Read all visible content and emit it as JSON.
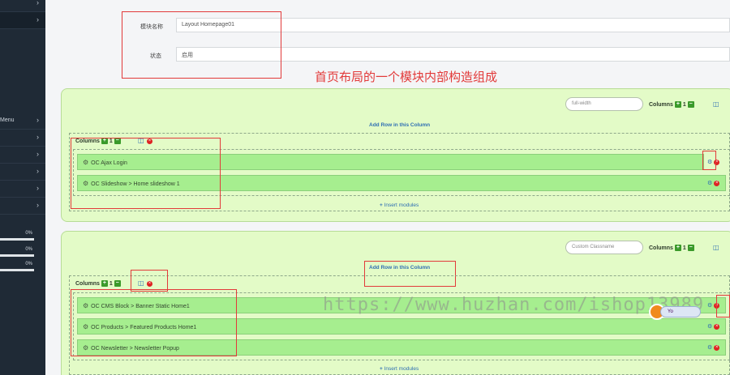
{
  "sidebar": {
    "menu_label": "Menu",
    "progress": [
      {
        "value": "0%"
      },
      {
        "value": "0%"
      },
      {
        "value": "0%"
      }
    ]
  },
  "form": {
    "module_name_label": "模块名称",
    "module_name_value": "Layout Homepage01",
    "status_label": "状态",
    "status_value": "启用"
  },
  "caption": "首页布局的一个模块内部构造组成",
  "panel1": {
    "class_input": "full-width",
    "columns_label": "Columns",
    "columns_count": "1",
    "add_row": "Add Row in this Column",
    "inner_columns_label": "Columns",
    "inner_columns_count": "1",
    "modules": [
      "OC Ajax Login",
      "OC Slideshow > Home slideshow 1"
    ],
    "insert_modules": "Insert modules"
  },
  "panel2": {
    "class_input_placeholder": "Custom Classname",
    "columns_label": "Columns",
    "columns_count": "1",
    "add_row": "Add Row in this Column",
    "inner_columns_label": "Columns",
    "inner_columns_count": "1",
    "modules": [
      "OC CMS Block > Banner Static Home1",
      "OC Products > Featured Products Home1",
      "OC Newsletter > Newsletter Popup"
    ],
    "insert_modules": "Insert modules"
  },
  "watermark": "https://www.huzhan.com/ishop13989",
  "badge_text": "Yo",
  "colors": {
    "sidebar": "#1f2a36",
    "panel_bg": "#e3fbc7",
    "module_row": "#a6ee8f",
    "annotation_red": "#e23a3a",
    "link_blue": "#2f6fb3",
    "add_green": "#3a9a2a"
  }
}
